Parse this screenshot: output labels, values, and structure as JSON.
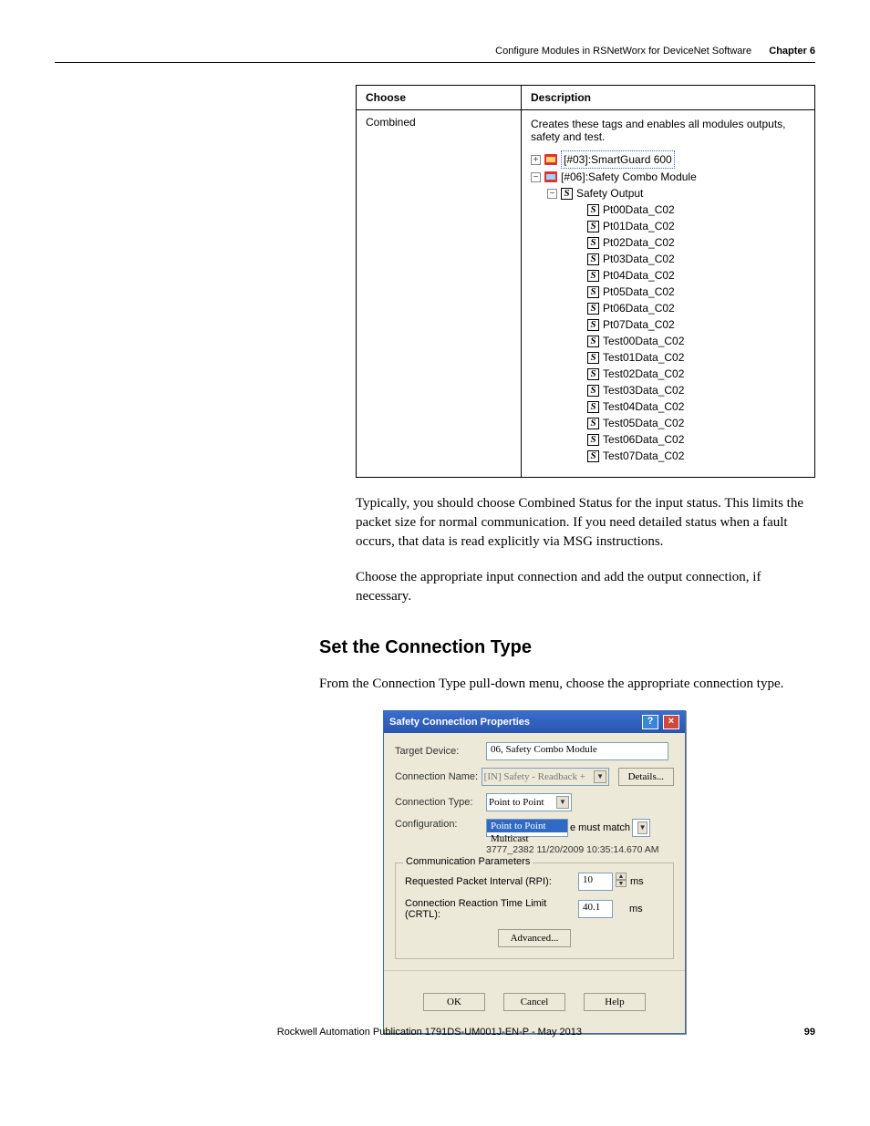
{
  "header": {
    "section_title": "Configure Modules in RSNetWorx for DeviceNet Software",
    "chapter": "Chapter 6"
  },
  "table": {
    "head_choose": "Choose",
    "head_desc": "Description",
    "choose_value": "Combined",
    "desc_text": "Creates these tags and enables all modules outputs, safety and test."
  },
  "tree": {
    "n1": "[#03]:SmartGuard 600",
    "n2": "[#06]:Safety Combo Module",
    "n3": "Safety Output",
    "leaves": [
      "Pt00Data_C02",
      "Pt01Data_C02",
      "Pt02Data_C02",
      "Pt03Data_C02",
      "Pt04Data_C02",
      "Pt05Data_C02",
      "Pt06Data_C02",
      "Pt07Data_C02",
      "Test00Data_C02",
      "Test01Data_C02",
      "Test02Data_C02",
      "Test03Data_C02",
      "Test04Data_C02",
      "Test05Data_C02",
      "Test06Data_C02",
      "Test07Data_C02"
    ]
  },
  "body": {
    "p1": "Typically, you should choose Combined Status for the input status. This limits the packet size for normal communication. If you need detailed status when a fault occurs, that data is read explicitly via MSG instructions.",
    "p2": "Choose the appropriate input connection and add the output connection, if necessary.",
    "h2": "Set the Connection Type",
    "p3": "From the Connection Type pull-down menu, choose the appropriate connection type."
  },
  "dialog": {
    "title": "Safety Connection Properties",
    "labels": {
      "target": "Target Device:",
      "conn_name": "Connection Name:",
      "conn_type": "Connection Type:",
      "config": "Configuration:"
    },
    "values": {
      "target": "06, Safety Combo Module",
      "conn_name": "[IN] Safety - Readback + ",
      "conn_type_selected": "Point to Point",
      "config_tail": "e must match",
      "config_sig": "3777_2382 11/20/2009 10:35:14.670 AM"
    },
    "options": {
      "p2p": "Point to Point",
      "multi": "Multicast"
    },
    "buttons": {
      "details": "Details...",
      "advanced": "Advanced...",
      "ok": "OK",
      "cancel": "Cancel",
      "help": "Help"
    },
    "group": {
      "legend": "Communication Parameters",
      "rpi_label": "Requested Packet Interval (RPI):",
      "rpi_value": "10",
      "rpi_unit": "ms",
      "crtl_label": "Connection Reaction Time Limit (CRTL):",
      "crtl_value": "40.1",
      "crtl_unit": "ms"
    }
  },
  "footer": {
    "pub": "Rockwell Automation Publication 1791DS-UM001J-EN-P - May 2013",
    "page": "99"
  }
}
